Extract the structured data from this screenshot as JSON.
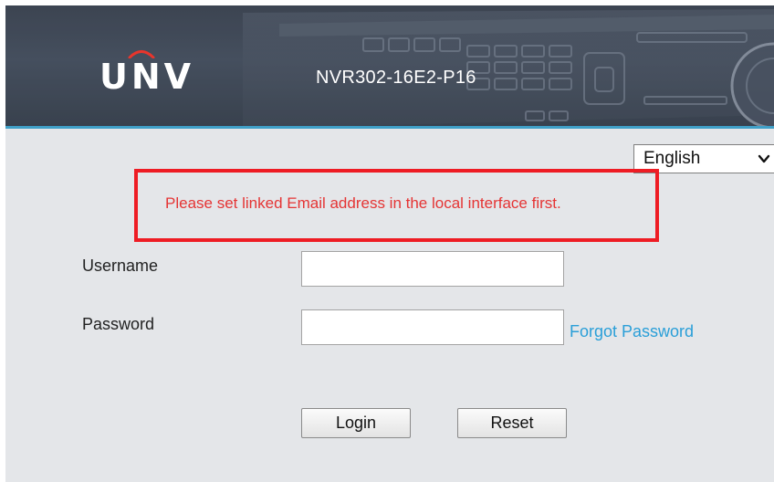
{
  "header": {
    "brand_logo": "UNV",
    "model": "NVR302-16E2-P16"
  },
  "language": {
    "selected": "English"
  },
  "alert": {
    "message": "Please set linked Email address in the local interface first."
  },
  "form": {
    "username_label": "Username",
    "password_label": "Password",
    "username_value": "",
    "password_value": "",
    "forgot_link": "Forgot Password",
    "login_button": "Login",
    "reset_button": "Reset"
  },
  "colors": {
    "header_bg": "#434c5b",
    "header_accent": "#3fa0c8",
    "alert_border": "#ee1c24",
    "alert_text": "#e53434",
    "link": "#2a9fd8",
    "page_bg": "#e4e6e9"
  },
  "icons": {
    "language_dropdown": "chevron-down-icon",
    "logo_arc": "logo-arc-icon"
  }
}
